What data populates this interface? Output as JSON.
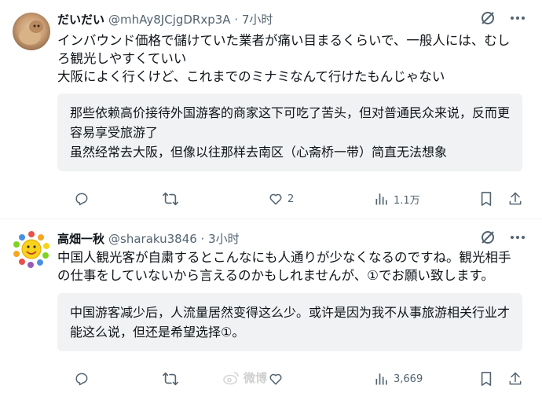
{
  "posts": [
    {
      "display_name": "だいだい",
      "handle_time": "@mhAy8JCjgDRxp3A · 7小时",
      "text": "インバウンド価格で儲けていた業者が痛い目まるくらいで、一般人には、むしろ観光しやすくていい\n大阪によく行くけど、これまでのミナミなんて行けたもんじゃない",
      "translation": "那些依赖高价接待外国游客的商家这下可吃了苦头，但对普通民众来说，反而更容易享受旅游了\n虽然经常去大阪，但像以往那样去南区（心斋桥一带）简直无法想象",
      "replies": "",
      "retweets": "",
      "likes": "2",
      "views": "1.1万"
    },
    {
      "display_name": "高畑一秋",
      "handle_time": "@sharaku3846 · 3小时",
      "text": "中国人観光客が自粛するとこんなにも人通りが少なくなるのですね。観光相手の仕事をしていないから言えるのかもしれませんが、①でお願い致します。",
      "translation": "中国游客减少后，人流量居然变得这么少。或许是因为我不从事旅游相关行业才能这么说，但还是希望选择①。",
      "replies": "",
      "retweets": "",
      "likes": "",
      "views": "3,669"
    }
  ],
  "icons": [
    "grok-icon",
    "more-icon",
    "reply-icon",
    "retweet-icon",
    "like-icon",
    "views-icon",
    "share-icon"
  ],
  "watermark": "微博",
  "colors": {
    "text": "#0f1419",
    "muted": "#536471",
    "translation_bg": "#f1f2f4",
    "divider": "#eff3f4"
  }
}
